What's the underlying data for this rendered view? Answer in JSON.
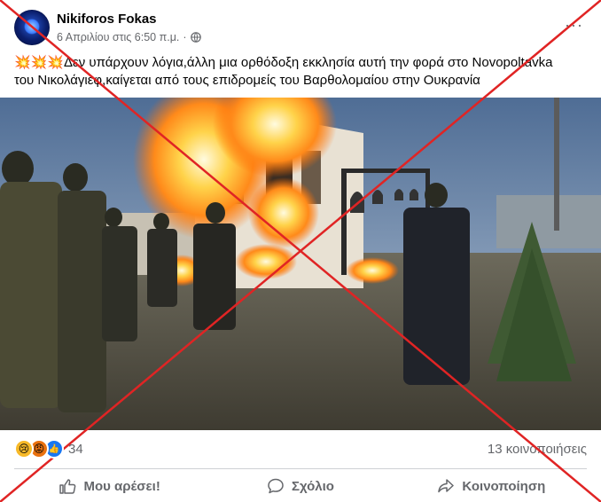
{
  "post": {
    "author": "Nikiforos Fokas",
    "date": "6 Απριλίου στις 6:50 π.μ.",
    "separator": "·",
    "more_label": "···",
    "emoji_prefix": "💥💥💥",
    "text_line1": "Δεν υπάρχουν λόγια,άλλη μια ορθόδοξη εκκλησία αυτή την φορά στο Novopoltavka",
    "text_line2": "του Νικολάγιεφ,καίγεται από τους επιδρομείς του Βαρθολομαίου στην Ουκρανία"
  },
  "reactions": {
    "count": "34",
    "shares": "13 κοινοποιήσεις",
    "icons": [
      "sad-emoji",
      "angry-emoji",
      "like-thumb"
    ]
  },
  "actions": {
    "like_label": "Μου αρέσει!",
    "comment_label": "Σχόλιο",
    "share_label": "Κοινοποίηση"
  },
  "overlay": {
    "cross_color": "#e02424"
  }
}
